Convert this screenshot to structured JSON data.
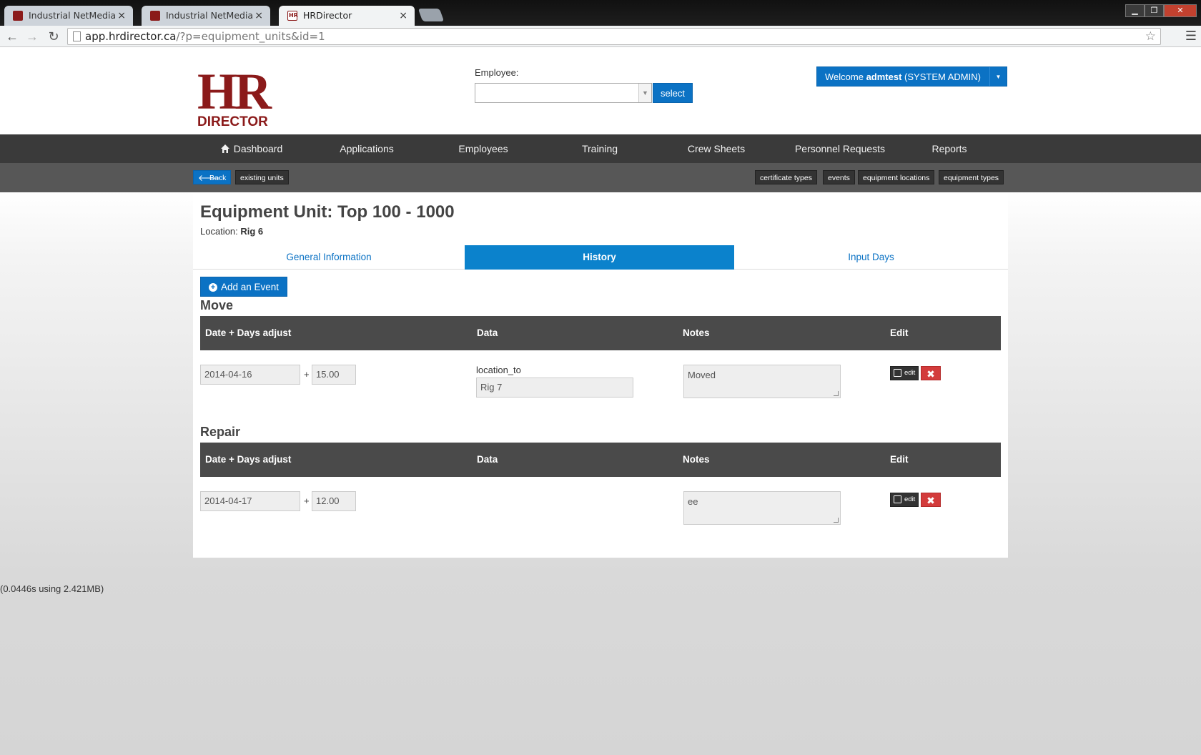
{
  "browser": {
    "tabs": [
      {
        "label": "Industrial NetMedia"
      },
      {
        "label": "Industrial NetMedia"
      },
      {
        "label": "HRDirector"
      }
    ],
    "url_host": "app.hrdirector.ca",
    "url_path": "/?p=equipment_units&id=1"
  },
  "header": {
    "logo_top": "HR",
    "logo_bottom": "DIRECTOR",
    "employee_label": "Employee:",
    "employee_value": "",
    "select_label": "select",
    "welcome_prefix": "Welcome ",
    "welcome_user": "admtest",
    "welcome_role": " (SYSTEM ADMIN)"
  },
  "nav": {
    "items": [
      "Dashboard",
      "Applications",
      "Employees",
      "Training",
      "Crew Sheets",
      "Personnel Requests",
      "Reports"
    ]
  },
  "subnav": {
    "back": "Back",
    "existing_units": "existing units",
    "links": [
      "certificate types",
      "events",
      "equipment locations",
      "equipment types"
    ]
  },
  "page": {
    "title": "Equipment Unit: Top 100 - 1000",
    "location_label": "Location: ",
    "location_value": "Rig 6",
    "tabs": [
      "General Information",
      "History",
      "Input Days"
    ],
    "active_tab": "History",
    "add_event": "Add an Event"
  },
  "table_headers": [
    "Date + Days adjust",
    "Data",
    "Notes",
    "Edit"
  ],
  "events": [
    {
      "section": "Move",
      "date": "2014-04-16",
      "days": "15.00",
      "data_label": "location_to",
      "data_value": "Rig 7",
      "notes": "Moved",
      "edit_label": "edit"
    },
    {
      "section": "Repair",
      "date": "2014-04-17",
      "days": "12.00",
      "data_label": "",
      "data_value": "",
      "notes": "ee",
      "edit_label": "edit"
    }
  ],
  "footer": {
    "stat": "(0.0446s using 2.421MB)"
  },
  "colors": {
    "brand": "#8b1a1a",
    "primary": "#0b72c4",
    "nav_bg": "#3a3a3a",
    "danger": "#d33b3b"
  }
}
